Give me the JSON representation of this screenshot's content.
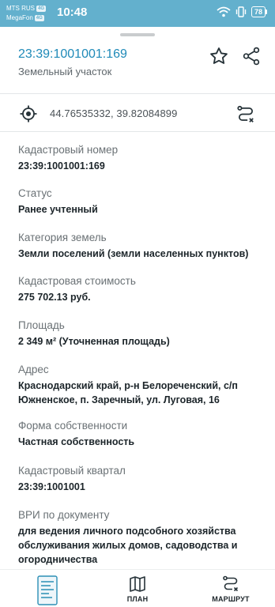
{
  "status_bar": {
    "carrier1": "MTS RUS",
    "carrier2": "MegaFon",
    "network_badge": "4G",
    "time": "10:48",
    "battery": "78"
  },
  "header": {
    "cadastral_number": "23:39:1001001:169",
    "object_type": "Земельный участок"
  },
  "coordinates": "44.76535332, 39.82084899",
  "fields": [
    {
      "label": "Кадастровый номер",
      "value": "23:39:1001001:169"
    },
    {
      "label": "Статус",
      "value": "Ранее учтенный"
    },
    {
      "label": "Категория земель",
      "value": "Земли поселений (земли населенных пунктов)"
    },
    {
      "label": "Кадастровая стоимость",
      "value": "275 702.13 руб."
    },
    {
      "label": "Площадь",
      "value": "2 349 м² (Уточненная площадь)"
    },
    {
      "label": "Адрес",
      "value": "Краснодарский край, р-н Белореченский, с/п Южненское, п. Заречный, ул. Луговая, 16"
    },
    {
      "label": "Форма собственности",
      "value": "Частная собственность"
    },
    {
      "label": "Кадастровый квартал",
      "value": "23:39:1001001"
    },
    {
      "label": "ВРИ по документу",
      "value": "для ведения личного подсобного хозяйства обслуживания жилых домов, садоводства и огородничества"
    }
  ],
  "bottom_nav": {
    "plan_label": "ПЛАН",
    "route_label": "МАРШРУТ"
  },
  "icons": {
    "favorite": "star-outline-icon",
    "share": "share-icon",
    "location": "crosshair-icon",
    "route": "route-icon",
    "plan": "map-icon",
    "document": "document-thumbnail-icon"
  },
  "colors": {
    "status_bar": "#63b0cd",
    "accent": "#1f8ab8"
  }
}
